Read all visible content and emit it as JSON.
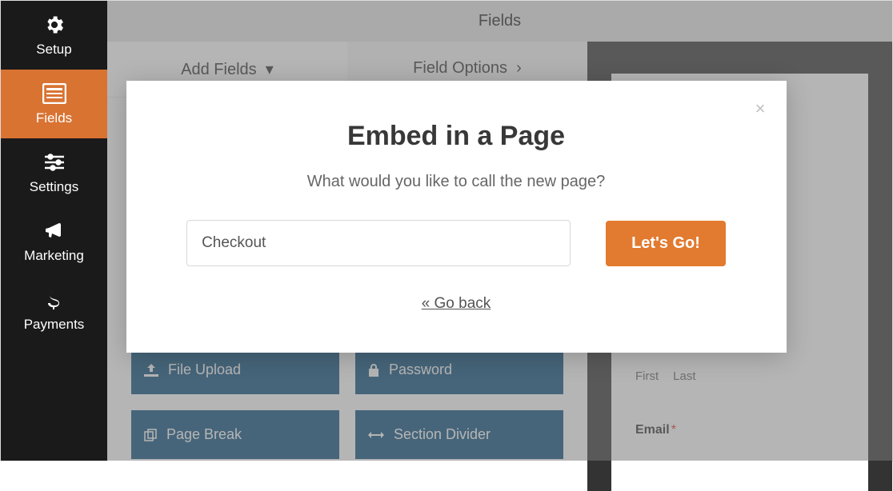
{
  "sidebar": {
    "items": [
      {
        "label": "Setup"
      },
      {
        "label": "Fields"
      },
      {
        "label": "Settings"
      },
      {
        "label": "Marketing"
      },
      {
        "label": "Payments"
      }
    ]
  },
  "topbar": {
    "title": "Fields"
  },
  "tabs": [
    {
      "label": "Add Fields"
    },
    {
      "label": "Field Options"
    }
  ],
  "field_buttons": [
    {
      "label": "File Upload"
    },
    {
      "label": "Password"
    },
    {
      "label": "Page Break"
    },
    {
      "label": "Section Divider"
    }
  ],
  "preview": {
    "name_first": "First",
    "name_last": "Last",
    "email_label": "Email",
    "required_marker": "*"
  },
  "modal": {
    "title": "Embed in a Page",
    "subtitle": "What would you like to call the new page?",
    "input_value": "Checkout",
    "submit_label": "Let's Go!",
    "back_label": "« Go back",
    "close_glyph": "×"
  }
}
